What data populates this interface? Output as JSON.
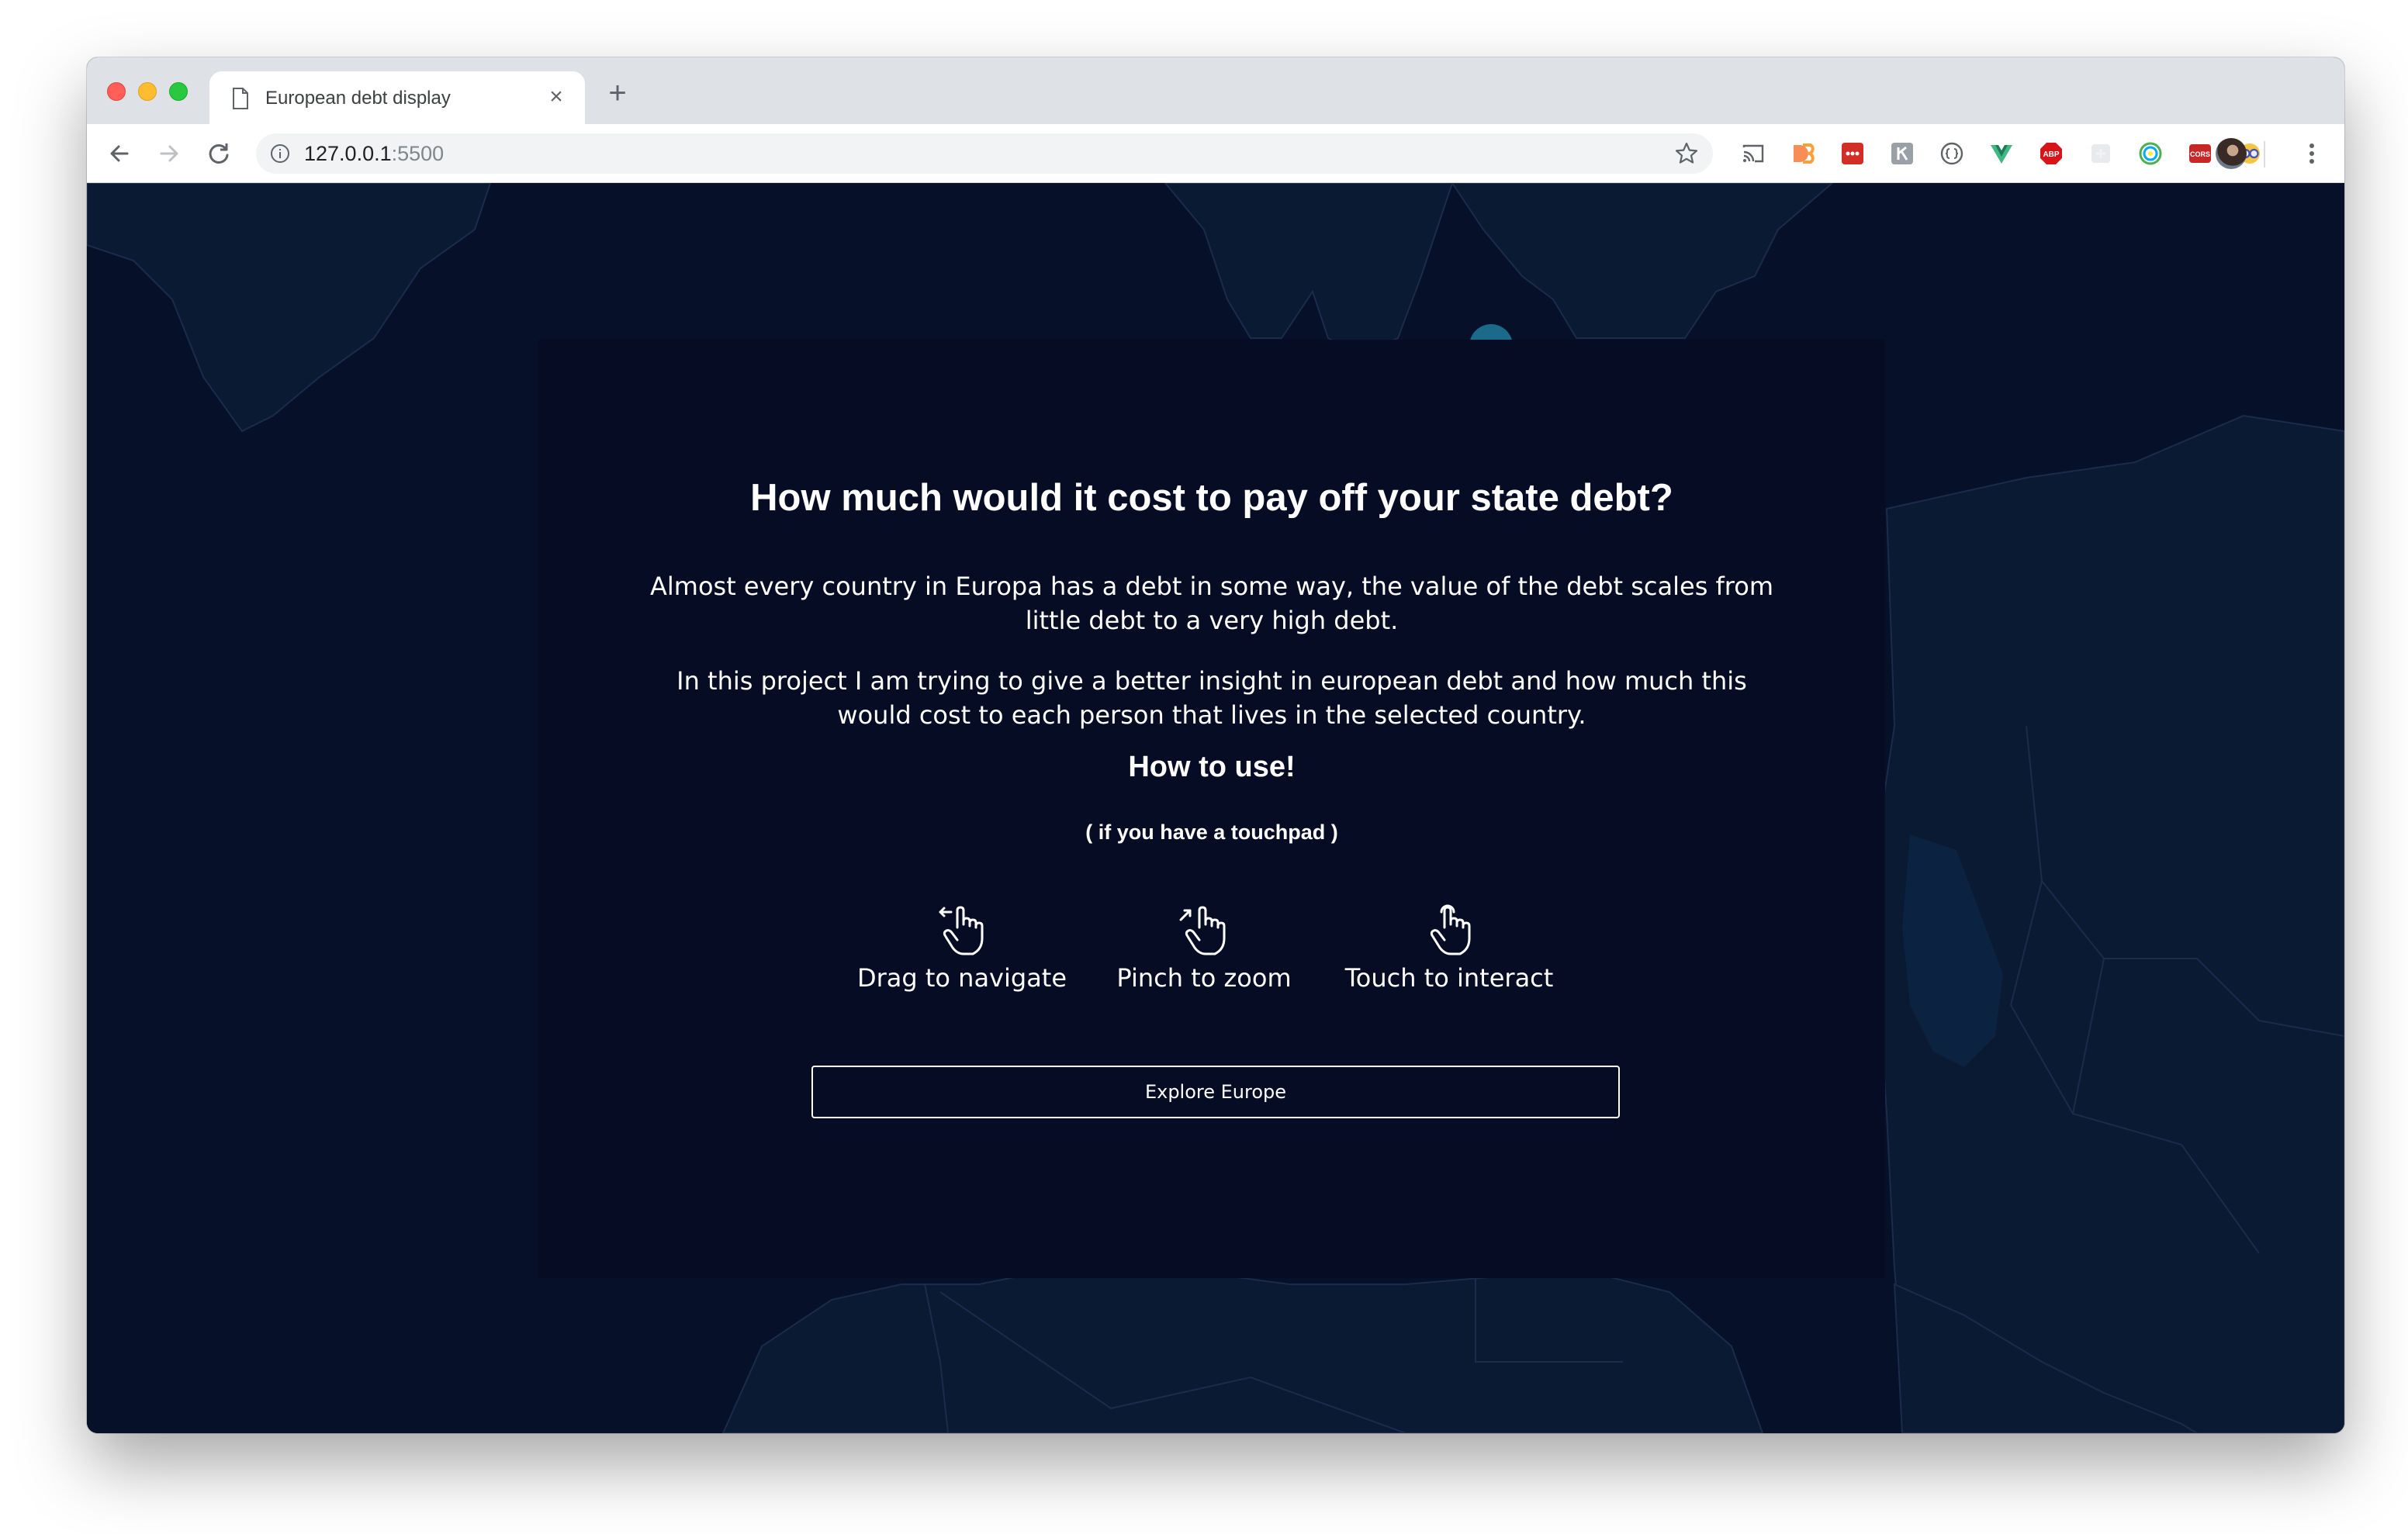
{
  "browser": {
    "tab_title": "European debt display",
    "tab_close_icon": "close-icon",
    "new_tab_icon": "plus-icon",
    "url_host": "127.0.0.1",
    "url_port": ":5500",
    "extensions": [
      {
        "name": "cast-icon",
        "color": "#5f6368"
      },
      {
        "name": "d3-extension-icon",
        "color": "#f68e56"
      },
      {
        "name": "lastpass-icon",
        "color": "#d32d27"
      },
      {
        "name": "extension-grey-icon",
        "color": "#9aa0a6"
      },
      {
        "name": "code-braces-icon",
        "color": "#5f6368"
      },
      {
        "name": "vue-devtools-icon",
        "color": "#1d7a5b"
      },
      {
        "name": "adblock-plus-icon",
        "color": "#d7141a"
      },
      {
        "name": "extension-light-icon",
        "color": "#dadce0"
      },
      {
        "name": "color-picker-icon",
        "color": "#4caf50"
      },
      {
        "name": "cors-icon",
        "color": "#c62828"
      },
      {
        "name": "glasses-icon",
        "color": "#3f51b5"
      }
    ],
    "adblock_label": "ABP",
    "cors_label": "CORS"
  },
  "modal": {
    "title": "How much would it cost to pay off your state debt?",
    "paragraph1": "Almost every country in Europa has a debt in some way, the value of the debt scales from little debt to a very high debt.",
    "paragraph2": "In this project I am trying to give a better insight in european debt and how much this would cost to each person that lives in the selected country.",
    "howto_title": "How to use!",
    "howto_subtitle": "( if you have a touchpad )",
    "gestures": [
      {
        "label": "Drag to navigate",
        "icon": "drag-hand-icon"
      },
      {
        "label": "Pinch to zoom",
        "icon": "pinch-hand-icon"
      },
      {
        "label": "Touch to interact",
        "icon": "touch-hand-icon"
      }
    ],
    "button_label": "Explore Europe"
  },
  "colors": {
    "map_land": "#0a1a33",
    "map_sea": "#061029",
    "modal_bg": "#050c24",
    "accent_marker": "#1b6a8a"
  }
}
